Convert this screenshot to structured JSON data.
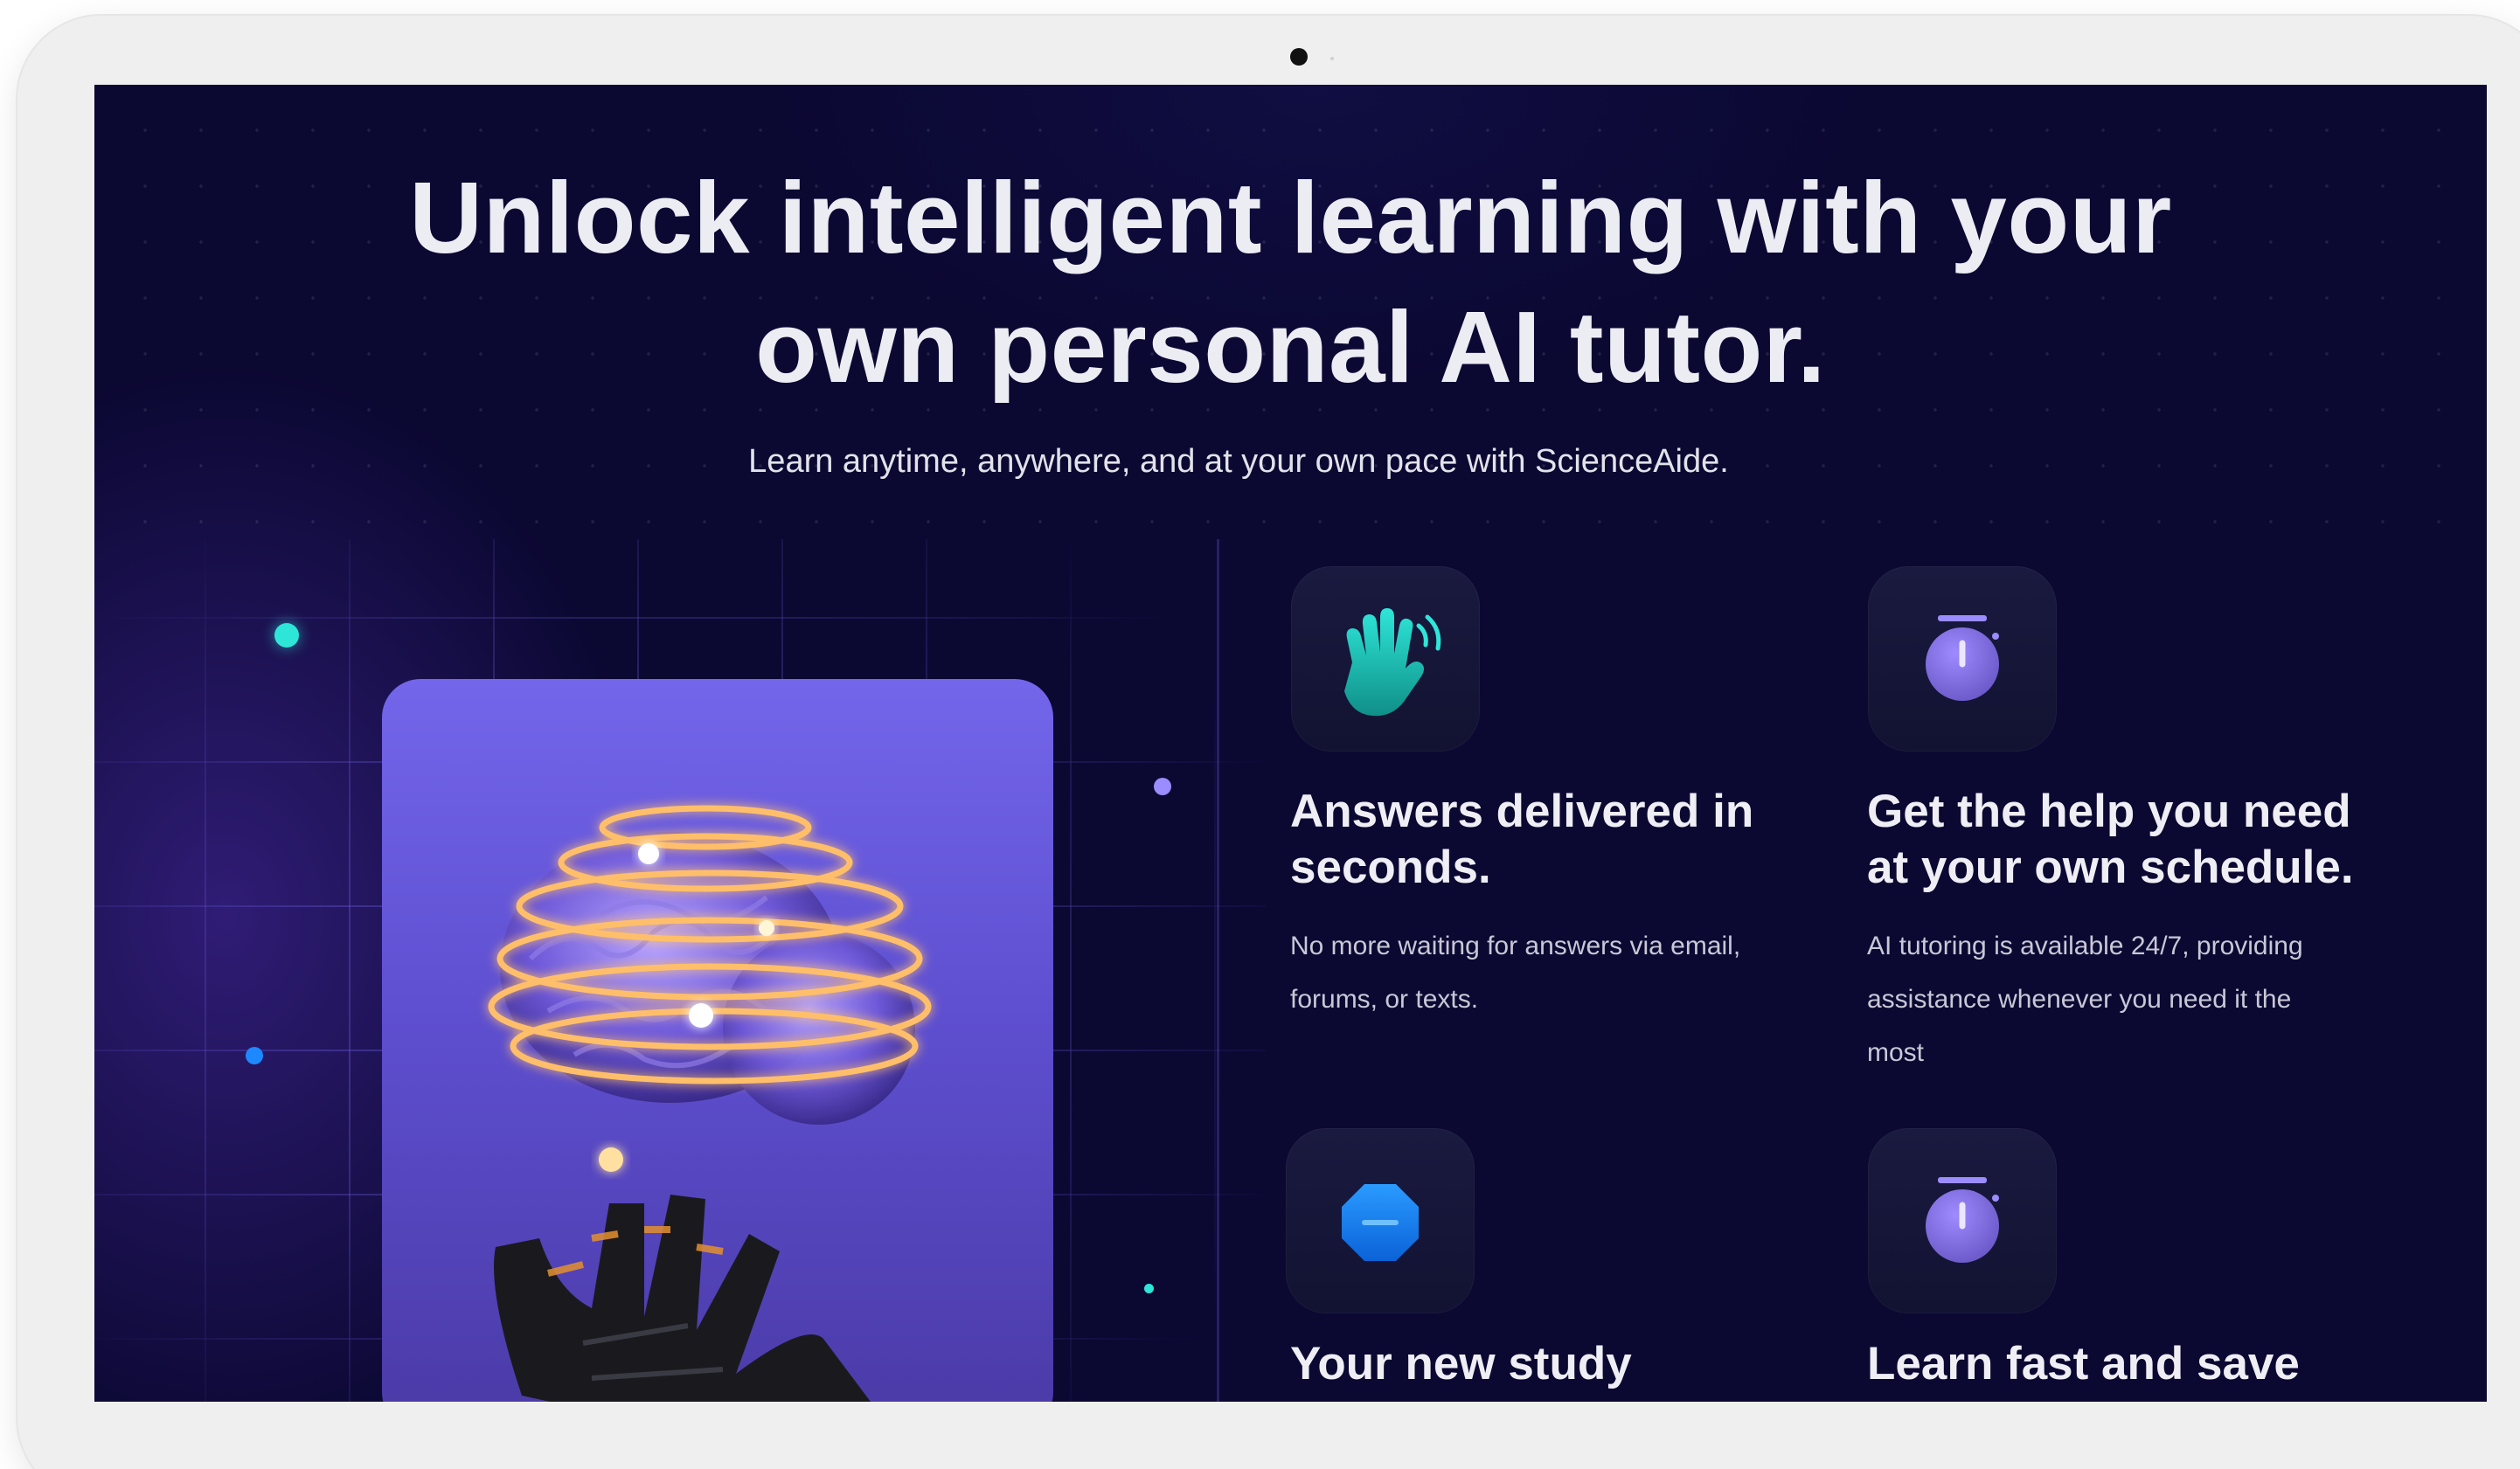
{
  "hero": {
    "headline_line1": "Unlock intelligent learning with your",
    "headline_line2": "own personal AI tutor.",
    "subtitle": "Learn anytime, anywhere, and at your own pace with ScienceAide."
  },
  "features": [
    {
      "icon": "waving-hand-icon",
      "title_line1": "Answers delivered in",
      "title_line2": "seconds.",
      "description_line1": "No more waiting for answers via email,",
      "description_line2": "forums, or texts.",
      "description_line3": ""
    },
    {
      "icon": "stopwatch-icon",
      "title_line1": "Get the help you need",
      "title_line2": "at your own schedule.",
      "description_line1": "AI tutoring is available 24/7, providing",
      "description_line2": "assistance whenever you need it the",
      "description_line3": "most"
    },
    {
      "icon": "octagon-minus-icon",
      "title_line1": "Your new study",
      "title_line2": "",
      "description_line1": "",
      "description_line2": "",
      "description_line3": ""
    },
    {
      "icon": "stopwatch-icon",
      "title_line1": "Learn fast and save",
      "title_line2": "",
      "description_line1": "",
      "description_line2": "",
      "description_line3": ""
    }
  ],
  "colors": {
    "background": "#0b0832",
    "teal_accent": "#2ee6d8",
    "purple_accent": "#9b8cff",
    "blue_accent": "#1e88ff",
    "card_purple": "#7466ea",
    "glow_orange": "#ffb347"
  }
}
